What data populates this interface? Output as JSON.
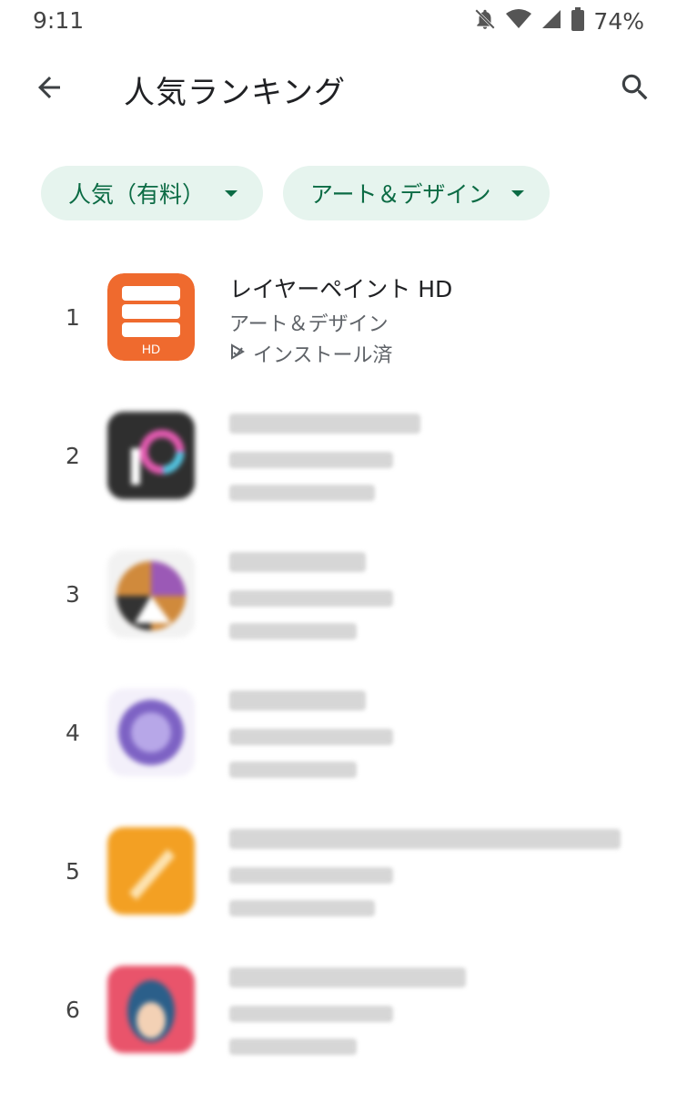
{
  "status_bar": {
    "time": "9:11",
    "battery": "74%",
    "icons": [
      "notifications-off-icon",
      "wifi-icon",
      "signal-icon",
      "battery-icon"
    ]
  },
  "appbar": {
    "title": "人気ランキング",
    "back_icon": "arrow-back-icon",
    "search_icon": "search-icon"
  },
  "filters": [
    {
      "label": "人気（有料）"
    },
    {
      "label": "アート＆デザイン"
    }
  ],
  "apps": [
    {
      "rank": "1",
      "title": "レイヤーペイント HD",
      "category": "アート＆デザイン",
      "status": "インストール済",
      "icon_badge": "HD",
      "icon_color": "#ef6a2e",
      "blurred": false
    },
    {
      "rank": "2",
      "blurred": true,
      "icon_color": "#2f2f2f"
    },
    {
      "rank": "3",
      "blurred": true,
      "icon_color": "#8a5a2e"
    },
    {
      "rank": "4",
      "blurred": true,
      "icon_color": "#8a72c9"
    },
    {
      "rank": "5",
      "blurred": true,
      "icon_color": "#f3a023"
    },
    {
      "rank": "6",
      "blurred": true,
      "icon_color": "#e9546b"
    }
  ],
  "colors": {
    "chip_bg": "#e6f4ee",
    "chip_text": "#0b6b44"
  }
}
